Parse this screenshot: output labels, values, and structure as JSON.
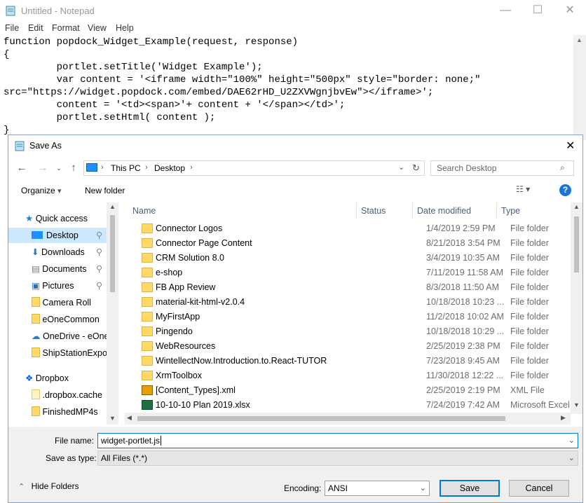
{
  "notepad": {
    "title": "Untitled - Notepad",
    "menu": [
      "File",
      "Edit",
      "Format",
      "View",
      "Help"
    ],
    "lines": [
      "function popdock_Widget_Example(request, response)",
      "{",
      "         portlet.setTitle('Widget Example');",
      "         var content = '<iframe width=\"100%\" height=\"500px\" style=\"border: none;\"",
      "src=\"https://widget.popdock.com/embed/DAE62rHD_U2ZXVWgnjbvEw\"></iframe>';",
      "         content = '<td><span>'+ content + '</span></td>';",
      "         portlet.setHtml( content );",
      "}"
    ]
  },
  "dialog": {
    "title": "Save As",
    "breadcrumb": [
      "This PC",
      "Desktop"
    ],
    "search_placeholder": "Search Desktop",
    "toolbar": {
      "organize": "Organize",
      "new_folder": "New folder"
    },
    "nav": [
      {
        "label": "Quick access",
        "icon": "star-icon",
        "indent": 0
      },
      {
        "label": "Desktop",
        "icon": "desktop-icon",
        "indent": 1,
        "pinned": true,
        "selected": true
      },
      {
        "label": "Downloads",
        "icon": "download-icon",
        "indent": 1,
        "pinned": true
      },
      {
        "label": "Documents",
        "icon": "documents-icon",
        "indent": 1,
        "pinned": true
      },
      {
        "label": "Pictures",
        "icon": "pictures-icon",
        "indent": 1,
        "pinned": true
      },
      {
        "label": "Camera Roll",
        "icon": "folder-icon",
        "indent": 1
      },
      {
        "label": "eOneCommon",
        "icon": "folder-icon",
        "indent": 1
      },
      {
        "label": "OneDrive - eOne",
        "icon": "onedrive-icon",
        "indent": 1
      },
      {
        "label": "ShipStationExpo",
        "icon": "folder-icon",
        "indent": 1
      },
      {
        "label": "Dropbox",
        "icon": "dropbox-icon",
        "indent": 0
      },
      {
        "label": ".dropbox.cache",
        "icon": "folder-icon",
        "indent": 1
      },
      {
        "label": "FinishedMP4s",
        "icon": "folder-icon",
        "indent": 1
      }
    ],
    "columns": {
      "name": "Name",
      "status": "Status",
      "date": "Date modified",
      "type": "Type"
    },
    "files": [
      {
        "name": "Connector Logos",
        "date": "1/4/2019 2:59 PM",
        "type": "File folder",
        "icon": "folder-icon"
      },
      {
        "name": "Connector Page Content",
        "date": "8/21/2018 3:54 PM",
        "type": "File folder",
        "icon": "folder-icon"
      },
      {
        "name": "CRM Solution 8.0",
        "date": "3/4/2019 10:35 AM",
        "type": "File folder",
        "icon": "folder-icon"
      },
      {
        "name": "e-shop",
        "date": "7/11/2019 11:58 AM",
        "type": "File folder",
        "icon": "folder-icon"
      },
      {
        "name": "FB App Review",
        "date": "8/3/2018 11:50 AM",
        "type": "File folder",
        "icon": "folder-icon"
      },
      {
        "name": "material-kit-html-v2.0.4",
        "date": "10/18/2018 10:23 ...",
        "type": "File folder",
        "icon": "folder-icon"
      },
      {
        "name": "MyFirstApp",
        "date": "11/2/2018 10:02 AM",
        "type": "File folder",
        "icon": "folder-icon"
      },
      {
        "name": "Pingendo",
        "date": "10/18/2018 10:29 ...",
        "type": "File folder",
        "icon": "folder-icon"
      },
      {
        "name": "WebResources",
        "date": "2/25/2019 2:38 PM",
        "type": "File folder",
        "icon": "folder-icon"
      },
      {
        "name": "WintellectNow.Introduction.to.React-TUTOR",
        "date": "7/23/2018 9:45 AM",
        "type": "File folder",
        "icon": "folder-icon"
      },
      {
        "name": "XrmToolbox",
        "date": "11/30/2018 12:22 ...",
        "type": "File folder",
        "icon": "folder-icon"
      },
      {
        "name": "[Content_Types].xml",
        "date": "2/25/2019 2:19 PM",
        "type": "XML File",
        "icon": "xml-file-icon"
      },
      {
        "name": "10-10-10 Plan 2019.xlsx",
        "date": "7/24/2019 7:42 AM",
        "type": "Microsoft Excel W...",
        "icon": "excel-file-icon"
      }
    ],
    "file_name_label": "File name:",
    "file_name_value": "widget-portlet.js",
    "save_type_label": "Save as type:",
    "save_type_value": "All Files  (*.*)",
    "hide_folders": "Hide Folders",
    "encoding_label": "Encoding:",
    "encoding_value": "ANSI",
    "save_button": "Save",
    "cancel_button": "Cancel"
  }
}
